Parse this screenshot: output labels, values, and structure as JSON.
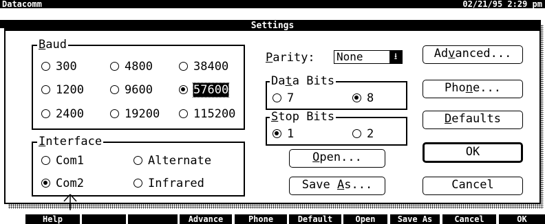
{
  "app": {
    "title": "Datacomm",
    "datetime": "02/21/95  2:29 pm"
  },
  "dialog": {
    "title": "Settings",
    "baud": {
      "label_first": "B",
      "label_rest": "aud",
      "options": [
        "300",
        "4800",
        "38400",
        "1200",
        "9600",
        "57600",
        "2400",
        "19200",
        "115200"
      ],
      "selected": "57600"
    },
    "interface": {
      "label_first": "I",
      "label_rest": "nterface",
      "options": [
        "Com1",
        "Alternate",
        "Com2",
        "Infrared"
      ],
      "selected": "Com2"
    },
    "parity": {
      "label_first": "P",
      "label_rest": "arity:",
      "value": "None",
      "dropdown_icon": "down-arrow"
    },
    "data_bits": {
      "label_pre": "Da",
      "label_u": "t",
      "label_post": "a Bits",
      "options": [
        "7",
        "8"
      ],
      "selected": "8"
    },
    "stop_bits": {
      "label_first": "S",
      "label_rest": "top Bits",
      "options": [
        "1",
        "2"
      ],
      "selected": "1"
    },
    "buttons": {
      "open": {
        "first": "O",
        "rest": "pen..."
      },
      "save_as": {
        "pre": "Save ",
        "u": "A",
        "post": "s..."
      },
      "advanced": {
        "pre": "Ad",
        "u": "v",
        "post": "anced..."
      },
      "phone": {
        "pre": "Pho",
        "u": "n",
        "post": "e..."
      },
      "defaults": {
        "first": "D",
        "rest": "efaults"
      },
      "ok": "OK",
      "cancel": "Cancel"
    }
  },
  "function_keys": [
    "Help",
    "",
    "",
    "Advance",
    "Phone",
    "Default",
    "Open",
    "Save As",
    "Cancel",
    "OK"
  ]
}
